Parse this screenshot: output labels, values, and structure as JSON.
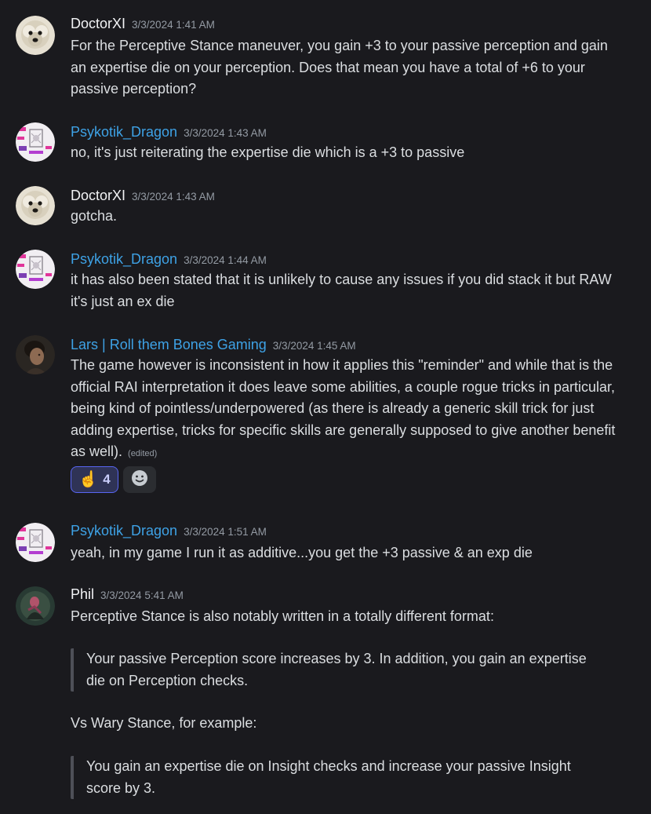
{
  "messages": [
    {
      "author": "DoctorXI",
      "timestamp": "3/3/2024 1:41 AM",
      "text": "For the Perceptive Stance maneuver, you gain +3 to your passive perception and gain an expertise die on your perception. Does that mean you have a total of +6 to your passive perception?"
    },
    {
      "author": "Psykotik_Dragon",
      "timestamp": "3/3/2024 1:43 AM",
      "text": "no, it's just reiterating the expertise die which is a +3 to passive"
    },
    {
      "author": "DoctorXI",
      "timestamp": "3/3/2024 1:43 AM",
      "text": "gotcha."
    },
    {
      "author": "Psykotik_Dragon",
      "timestamp": "3/3/2024 1:44 AM",
      "text": "it has also been stated that it is unlikely to cause any issues if you did stack it but RAW it's just an ex die"
    },
    {
      "author": "Lars | Roll them Bones Gaming",
      "timestamp": "3/3/2024 1:45 AM",
      "text": "The game however is inconsistent in how it applies this \"reminder\" and while that is the official RAI interpretation it does leave some abilities, a couple rogue tricks in particular, being kind of pointless/underpowered (as there is already a generic skill trick for just adding expertise, tricks for specific skills are generally supposed to give another benefit as well).",
      "edited": "(edited)",
      "reaction": {
        "emoji": "☝️",
        "count": "4"
      },
      "add_reaction_icon": "smiley-face-icon"
    },
    {
      "author": "Psykotik_Dragon",
      "timestamp": "3/3/2024 1:51 AM",
      "text": "yeah, in my game I run it as additive...you get the +3 passive & an exp die"
    },
    {
      "author": "Phil",
      "timestamp": "3/3/2024 5:41 AM",
      "text": "Perceptive Stance is also notably written in a totally different format:",
      "quote1": "Your passive Perception score increases by 3. In addition, you gain an expertise die on Perception checks.",
      "text2": "Vs Wary Stance, for example:",
      "quote2": "You gain an expertise die on Insight checks and increase your passive Insight score by 3."
    }
  ],
  "colors": {
    "background": "#1a1a1e",
    "username_white": "#f2f3f5",
    "username_blue": "#3ea2e6",
    "timestamp": "#949ba4",
    "text": "#dbdee1",
    "reaction_active_bg": "#2f3356",
    "reaction_active_border": "#5865f2"
  }
}
